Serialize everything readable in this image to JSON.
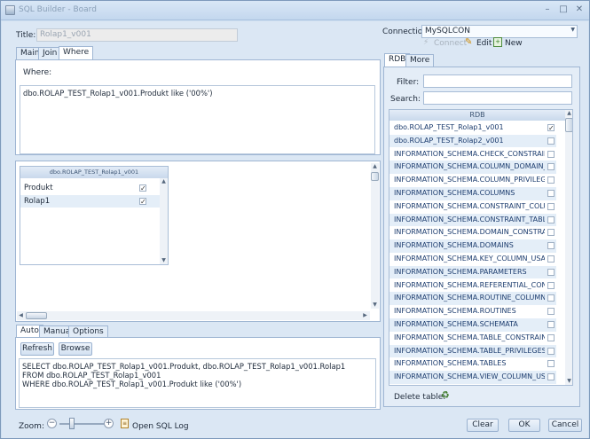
{
  "window": {
    "title": "SQL Builder - Board"
  },
  "title_field": {
    "label": "Title:",
    "value": "Rolap1_v001"
  },
  "top_tabs": [
    {
      "label": "Main"
    },
    {
      "label": "Join"
    },
    {
      "label": "Where"
    }
  ],
  "where": {
    "label": "Where:",
    "text": "dbo.ROLAP_TEST_Rolap1_v001.Produkt like ('00%')"
  },
  "table_box": {
    "header": "dbo.ROLAP_TEST_Rolap1_v001",
    "rows": [
      {
        "name": "Produkt",
        "checked": true
      },
      {
        "name": "Rolap1",
        "checked": true
      }
    ]
  },
  "bottom_tabs": [
    {
      "label": "Auto"
    },
    {
      "label": "Manual"
    },
    {
      "label": "Options"
    }
  ],
  "bottom_buttons": {
    "refresh": "Refresh",
    "browse": "Browse"
  },
  "sql_text": [
    "SELECT dbo.ROLAP_TEST_Rolap1_v001.Produkt, dbo.ROLAP_TEST_Rolap1_v001.Rolap1",
    "FROM dbo.ROLAP_TEST_Rolap1_v001",
    "WHERE dbo.ROLAP_TEST_Rolap1_v001.Produkt like ('00%')"
  ],
  "connection": {
    "label": "Connection:",
    "value": "MySQLCON",
    "connect": "Connect",
    "edit": "Edit",
    "new": "New"
  },
  "right_tabs": [
    {
      "label": "RDB"
    },
    {
      "label": "More"
    }
  ],
  "filter": {
    "label": "Filter:",
    "value": ""
  },
  "search": {
    "label": "Search:",
    "value": ""
  },
  "rdb_list": {
    "header": "RDB",
    "items": [
      {
        "name": "dbo.ROLAP_TEST_Rolap1_v001",
        "checked": true
      },
      {
        "name": "dbo.ROLAP_TEST_Rolap2_v001",
        "checked": false
      },
      {
        "name": "INFORMATION_SCHEMA.CHECK_CONSTRAINTS",
        "checked": false
      },
      {
        "name": "INFORMATION_SCHEMA.COLUMN_DOMAIN_USAGE",
        "checked": false
      },
      {
        "name": "INFORMATION_SCHEMA.COLUMN_PRIVILEGES",
        "checked": false
      },
      {
        "name": "INFORMATION_SCHEMA.COLUMNS",
        "checked": false
      },
      {
        "name": "INFORMATION_SCHEMA.CONSTRAINT_COLUMN_USAGE",
        "checked": false
      },
      {
        "name": "INFORMATION_SCHEMA.CONSTRAINT_TABLE_USAGE",
        "checked": false
      },
      {
        "name": "INFORMATION_SCHEMA.DOMAIN_CONSTRAINTS",
        "checked": false
      },
      {
        "name": "INFORMATION_SCHEMA.DOMAINS",
        "checked": false
      },
      {
        "name": "INFORMATION_SCHEMA.KEY_COLUMN_USAGE",
        "checked": false
      },
      {
        "name": "INFORMATION_SCHEMA.PARAMETERS",
        "checked": false
      },
      {
        "name": "INFORMATION_SCHEMA.REFERENTIAL_CONSTRAINTS",
        "checked": false
      },
      {
        "name": "INFORMATION_SCHEMA.ROUTINE_COLUMNS",
        "checked": false
      },
      {
        "name": "INFORMATION_SCHEMA.ROUTINES",
        "checked": false
      },
      {
        "name": "INFORMATION_SCHEMA.SCHEMATA",
        "checked": false
      },
      {
        "name": "INFORMATION_SCHEMA.TABLE_CONSTRAINTS",
        "checked": false
      },
      {
        "name": "INFORMATION_SCHEMA.TABLE_PRIVILEGES",
        "checked": false
      },
      {
        "name": "INFORMATION_SCHEMA.TABLES",
        "checked": false
      },
      {
        "name": "INFORMATION_SCHEMA.VIEW_COLUMN_USAGE",
        "checked": false
      }
    ]
  },
  "delete_table": {
    "label": "Delete table:"
  },
  "zoom": {
    "label": "Zoom:",
    "level": 0.28
  },
  "sql_log": {
    "label": "Open SQL Log"
  },
  "dialog_buttons": {
    "clear": "Clear",
    "ok": "OK",
    "cancel": "Cancel"
  },
  "icons": {
    "connect": "plug-icon",
    "edit": "pencil-icon",
    "new": "new-document-icon",
    "delete": "recycle-bin-icon",
    "sql_log": "document-icon"
  },
  "colors": {
    "accent": "#1c3c6e",
    "frame": "#cfe0f1",
    "panel_border": "#9fb6d3",
    "selected_row": "#e4eef8"
  }
}
